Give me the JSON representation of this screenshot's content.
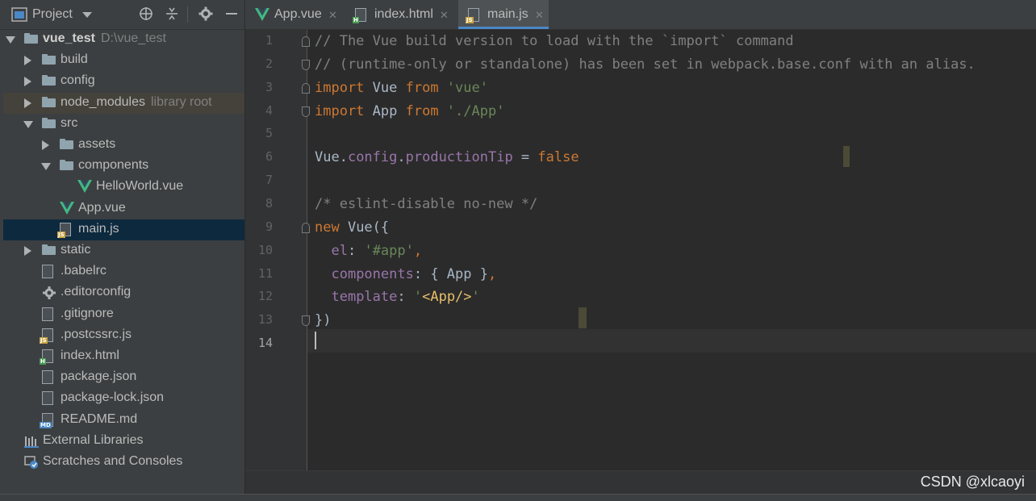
{
  "project_panel": {
    "title": "Project",
    "tools": [
      "crosshair-icon",
      "collapse-icon",
      "gear-icon",
      "minimize-icon"
    ]
  },
  "tree": [
    {
      "label": "vue_test",
      "hint": "D:\\vue_test",
      "icon": "folder",
      "arrow": "down",
      "indent": 0,
      "bold": true
    },
    {
      "label": "build",
      "icon": "folder",
      "arrow": "right",
      "indent": 1
    },
    {
      "label": "config",
      "icon": "folder",
      "arrow": "right",
      "indent": 1
    },
    {
      "label": "node_modules",
      "hint": "library root",
      "icon": "folder",
      "arrow": "right",
      "indent": 1,
      "lib": true
    },
    {
      "label": "src",
      "icon": "folder",
      "arrow": "down",
      "indent": 1
    },
    {
      "label": "assets",
      "icon": "folder",
      "arrow": "right",
      "indent": 2
    },
    {
      "label": "components",
      "icon": "folder",
      "arrow": "down",
      "indent": 2
    },
    {
      "label": "HelloWorld.vue",
      "icon": "vue",
      "indent": 3
    },
    {
      "label": "App.vue",
      "icon": "vue",
      "indent": 2
    },
    {
      "label": "main.js",
      "icon": "js",
      "indent": 2,
      "selected": true
    },
    {
      "label": "static",
      "icon": "folder",
      "arrow": "right",
      "indent": 1
    },
    {
      "label": ".babelrc",
      "icon": "config-file",
      "indent": 1
    },
    {
      "label": ".editorconfig",
      "icon": "gear",
      "indent": 1
    },
    {
      "label": ".gitignore",
      "icon": "ignore-file",
      "indent": 1
    },
    {
      "label": ".postcssrc.js",
      "icon": "js",
      "indent": 1
    },
    {
      "label": "index.html",
      "icon": "html",
      "indent": 1
    },
    {
      "label": "package.json",
      "icon": "json",
      "indent": 1
    },
    {
      "label": "package-lock.json",
      "icon": "json",
      "indent": 1
    },
    {
      "label": "README.md",
      "icon": "md",
      "indent": 1
    },
    {
      "label": "External Libraries",
      "icon": "libraries",
      "indent": 0
    },
    {
      "label": "Scratches and Consoles",
      "icon": "scratches",
      "indent": 0
    }
  ],
  "tabs": [
    {
      "label": "App.vue",
      "icon": "vue",
      "active": false
    },
    {
      "label": "index.html",
      "icon": "html",
      "active": false
    },
    {
      "label": "main.js",
      "icon": "js",
      "active": true
    }
  ],
  "badges": {
    "js": "JS",
    "html": "H",
    "md": "MD"
  },
  "line_numbers": [
    "1",
    "2",
    "3",
    "4",
    "5",
    "6",
    "7",
    "8",
    "9",
    "10",
    "11",
    "12",
    "13",
    "14"
  ],
  "current_line": "14",
  "code": [
    [
      [
        "cm",
        "// The Vue build version to load with the `import` command"
      ]
    ],
    [
      [
        "cm",
        "// (runtime-only or standalone) has been set in webpack.base.conf with an alias."
      ]
    ],
    [
      [
        "kw",
        "import "
      ],
      [
        "id",
        "Vue "
      ],
      [
        "kw",
        "from "
      ],
      [
        "st",
        "'vue'"
      ]
    ],
    [
      [
        "kw",
        "import "
      ],
      [
        "id",
        "App "
      ],
      [
        "kw",
        "from "
      ],
      [
        "st",
        "'./App'"
      ]
    ],
    [],
    [
      [
        "id",
        "Vue."
      ],
      [
        "pr",
        "config"
      ],
      [
        "id",
        "."
      ],
      [
        "pr",
        "productionTip"
      ],
      [
        "id",
        " = "
      ],
      [
        "kw",
        "false"
      ]
    ],
    [],
    [
      [
        "cm",
        "/* eslint-disable no-new */"
      ]
    ],
    [
      [
        "kw",
        "new "
      ],
      [
        "id",
        "Vue({"
      ]
    ],
    [
      [
        "id",
        "  "
      ],
      [
        "pr",
        "el"
      ],
      [
        "id",
        ": "
      ],
      [
        "st",
        "'#app'"
      ],
      [
        "kw",
        ","
      ]
    ],
    [
      [
        "id",
        "  "
      ],
      [
        "pr",
        "components"
      ],
      [
        "id",
        ": { App }"
      ],
      [
        "kw",
        ","
      ]
    ],
    [
      [
        "id",
        "  "
      ],
      [
        "pr",
        "template"
      ],
      [
        "id",
        ": "
      ],
      [
        "st",
        "'"
      ],
      [
        "ht",
        "<App/>"
      ],
      [
        "st",
        "'"
      ]
    ],
    [
      [
        "id",
        "})"
      ]
    ],
    []
  ],
  "watermark": "CSDN @xlcaoyi",
  "colors": {
    "accent": "#4a88c7",
    "vue": "#41b883",
    "keyword": "#cc7832",
    "string": "#6a8759",
    "property": "#9876aa",
    "comment": "#808080"
  }
}
